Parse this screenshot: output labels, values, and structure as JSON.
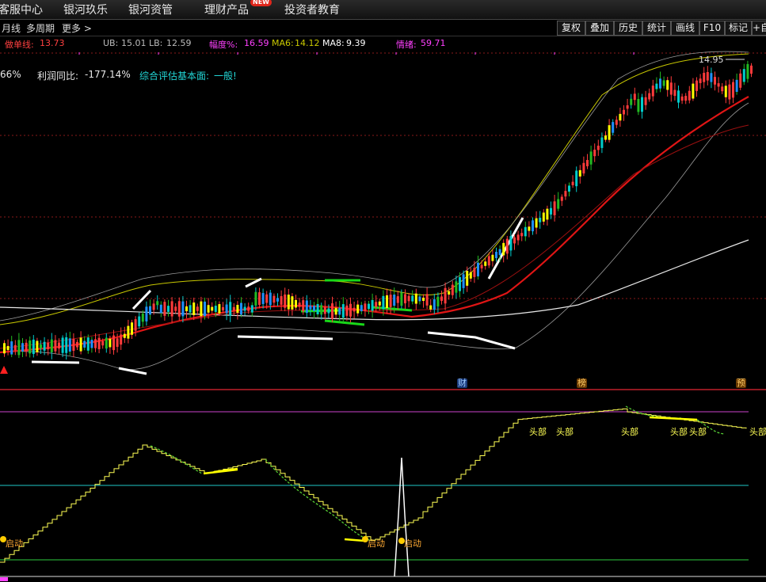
{
  "topnav": {
    "items": [
      "客服中心",
      "银河玖乐",
      "银河资管",
      "理财产品",
      "投资者教育"
    ],
    "badge": "NEW"
  },
  "toolbar": {
    "left": [
      "月线",
      "多周期",
      "更多 >"
    ],
    "buttons": [
      "复权",
      "叠加",
      "历史",
      "统计",
      "画线",
      "F10",
      "标记",
      "+自"
    ]
  },
  "indicators": {
    "zuodan_label": "做单线:",
    "zuodan_value": "13.73",
    "ub_label": "UB:",
    "ub_value": "15.01",
    "lb_label": "LB:",
    "lb_value": "12.59",
    "fudu_label": "幅度%:",
    "fudu_value": "16.59",
    "ma6_label": "MA6:",
    "ma6_value": "14.12",
    "ma8_label": "MA8:",
    "ma8_value": "9.39",
    "qingxu_label": "情绪:",
    "qingxu_value": "59.71"
  },
  "fundamentals": {
    "pct": "66%",
    "profit_label": "利润同比:",
    "profit_value": "-177.14%",
    "eval_label": "综合评估基本面:",
    "eval_value": "一般!"
  },
  "price_chart": {
    "high_price_label": "14.95",
    "event_markers": [
      "财",
      "榜",
      "预"
    ]
  },
  "lower_panel": {
    "signal_top": "头部",
    "signal_start": "启动",
    "top_labels": [
      "头部",
      "头部",
      "头部",
      "头部",
      "头部",
      "头部"
    ],
    "start_labels": [
      "启动",
      "启动",
      "启动"
    ]
  },
  "colors": {
    "up": "#ff3b3b",
    "down": "#00d0d0",
    "accent_yellow": "#ffff00",
    "magenta": "#ff40ff",
    "cyan_line": "#1fc9c9",
    "green_line": "#2ecc40"
  }
}
